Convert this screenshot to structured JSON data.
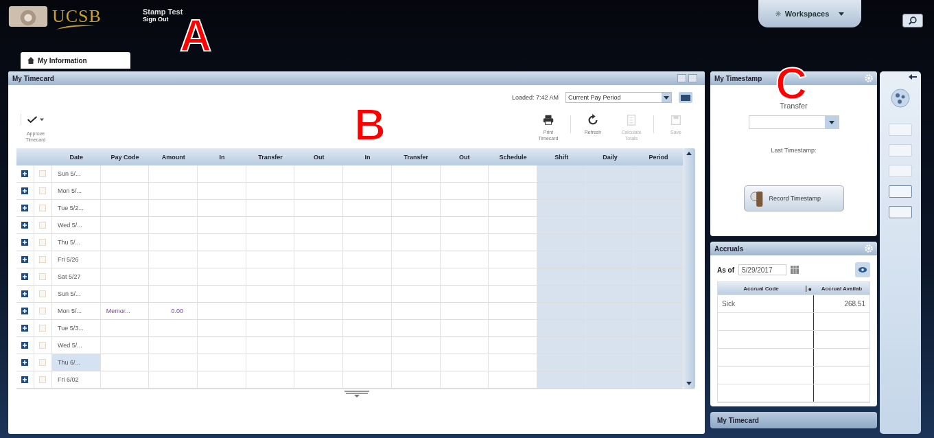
{
  "header": {
    "logo_text": "UCSB",
    "user_name": "Stamp Test",
    "sign_out": "Sign Out",
    "workspaces": "Workspaces"
  },
  "tabs": [
    {
      "label": "My Information",
      "selected": true
    }
  ],
  "timecard": {
    "title": "My Timecard",
    "loaded": "Loaded: 7:42 AM",
    "period": "Current Pay Period",
    "approve": "Approve Timecard",
    "tools": [
      {
        "label": "Print Timecard",
        "kind": "print",
        "disabled": false
      },
      {
        "label": "Refresh",
        "kind": "refresh",
        "disabled": false
      },
      {
        "label": "Calculate Totals",
        "kind": "calculate",
        "disabled": true
      },
      {
        "label": "Save",
        "kind": "save",
        "disabled": true
      }
    ],
    "columns": [
      {
        "label": "Date",
        "kind": "entry"
      },
      {
        "label": "Pay Code",
        "kind": "entry"
      },
      {
        "label": "Amount",
        "kind": "entry"
      },
      {
        "label": "In",
        "kind": "entry"
      },
      {
        "label": "Transfer",
        "kind": "entry"
      },
      {
        "label": "Out",
        "kind": "entry"
      },
      {
        "label": "In",
        "kind": "entry"
      },
      {
        "label": "Transfer",
        "kind": "entry"
      },
      {
        "label": "Out",
        "kind": "entry"
      },
      {
        "label": "Schedule",
        "kind": "entry"
      },
      {
        "label": "Shift",
        "kind": "total"
      },
      {
        "label": "Daily",
        "kind": "total"
      },
      {
        "label": "Period",
        "kind": "total"
      }
    ],
    "rows": [
      {
        "date": "Sun 5/...",
        "selected": false
      },
      {
        "date": "Mon 5/...",
        "selected": false
      },
      {
        "date": "Tue 5/2...",
        "selected": false
      },
      {
        "date": "Wed 5/...",
        "selected": false
      },
      {
        "date": "Thu 5/...",
        "selected": false
      },
      {
        "date": "Fri 5/26",
        "selected": false
      },
      {
        "date": "Sat 5/27",
        "selected": false
      },
      {
        "date": "Sun 5/...",
        "selected": false
      },
      {
        "date": "Mon 5/...",
        "pay_code": "Memor...",
        "amount": "0.00",
        "selected": false
      },
      {
        "date": "Tue 5/3...",
        "selected": false
      },
      {
        "date": "Wed 5/...",
        "selected": false
      },
      {
        "date": "Thu 6/...",
        "selected": true
      },
      {
        "date": "Fri 6/02",
        "selected": false
      }
    ]
  },
  "timestamp": {
    "title": "My Timestamp",
    "transfer_label": "Transfer",
    "last_label": "Last Timestamp:",
    "button": "Record Timestamp"
  },
  "accruals": {
    "title": "Accruals",
    "as_of_label": "As of",
    "as_of": "5/29/2017",
    "columns": [
      "Accrual Code",
      "Accrual Availab"
    ],
    "rows": [
      {
        "code": "Sick",
        "available": "268.51"
      }
    ]
  },
  "collapsed_panel": {
    "title": "My Timecard"
  },
  "annotations": [
    {
      "letter": "A",
      "kind": "a"
    },
    {
      "letter": "B",
      "kind": "b"
    },
    {
      "letter": "C",
      "kind": "c"
    }
  ]
}
